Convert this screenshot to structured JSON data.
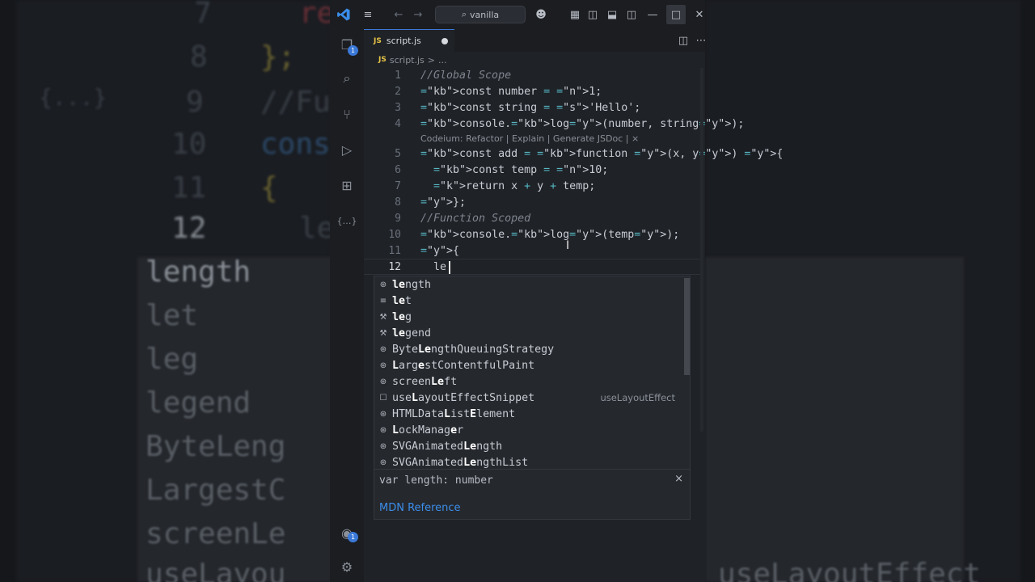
{
  "title_bar": {
    "search_text": "vanilla",
    "back_icon": "arrow-left",
    "forward_icon": "arrow-right"
  },
  "activity_bar": {
    "explorer_badge": "1",
    "account_badge": "1"
  },
  "tab": {
    "js_label": "JS",
    "file_name": "script.js"
  },
  "breadcrumb": {
    "js_label": "JS",
    "file": "script.js",
    "separator": ">",
    "more": "..."
  },
  "editor": {
    "line_numbers": [
      "1",
      "2",
      "3",
      "4",
      "5",
      "6",
      "7",
      "8",
      "9",
      "10",
      "11",
      "12"
    ],
    "code_lens": "Codeium: Refactor | Explain | Generate JSDoc | ×",
    "lines": [
      "//Global Scope",
      "const number = 1;",
      "const string = 'Hello';",
      "console.log(number, string);",
      "const add = function (x, y) {",
      "  const temp = 10;",
      "  return x + y + temp;",
      "};",
      "//Function Scoped",
      "console.log(temp);",
      "{",
      "  le"
    ]
  },
  "suggestions": [
    {
      "icon": "variable-icon",
      "pre": "",
      "hl": "le",
      "post": "ngth",
      "detail": ""
    },
    {
      "icon": "keyword-icon",
      "pre": "",
      "hl": "le",
      "post": "t",
      "detail": ""
    },
    {
      "icon": "wrench-icon",
      "pre": "",
      "hl": "le",
      "post": "g",
      "detail": ""
    },
    {
      "icon": "wrench-icon",
      "pre": "",
      "hl": "le",
      "post": "gend",
      "detail": ""
    },
    {
      "icon": "variable-icon",
      "pre": "Byte",
      "hl": "Le",
      "post": "ngthQueuingStrategy",
      "detail": ""
    },
    {
      "icon": "variable-icon",
      "pre": "",
      "hl": "L",
      "post": "arg",
      "post2": "e",
      "post3": "stContentfulPaint",
      "detail": ""
    },
    {
      "icon": "variable-icon",
      "pre": "screen",
      "hl": "Le",
      "post": "ft",
      "detail": ""
    },
    {
      "icon": "snippet-icon",
      "pre": "use",
      "hl": "L",
      "post": "ayoutEffectSnippet",
      "detail": "useLayoutEffect"
    },
    {
      "icon": "variable-icon",
      "pre": "HTMLData",
      "hl": "L",
      "post": "ist",
      "post2": "E",
      "post3": "lement",
      "detail": ""
    },
    {
      "icon": "variable-icon",
      "pre": "",
      "hl": "L",
      "post": "ockManag",
      "post2": "e",
      "post3": "r",
      "detail": ""
    },
    {
      "icon": "variable-icon",
      "pre": "SVGAnimated",
      "hl": "Le",
      "post": "ngth",
      "detail": ""
    },
    {
      "icon": "variable-icon",
      "pre": "SVGAnimated",
      "hl": "Le",
      "post": "ngthList",
      "detail": ""
    }
  ],
  "docs": {
    "signature": "var length: number",
    "close": "×",
    "link": "MDN Reference"
  },
  "background": {
    "code_lines": [
      "re",
      "};",
      "//Fu",
      "cons",
      "{",
      "le"
    ],
    "line_numbers": [
      "7",
      "8",
      "9",
      "10",
      "11",
      "12"
    ],
    "brace_label": "{...}",
    "suggestions": [
      "length",
      "let",
      "leg",
      "legend",
      "ByteLeng",
      "LargestC",
      "screenLe",
      "useLayou"
    ],
    "right_detail": "useLayoutEffect"
  }
}
